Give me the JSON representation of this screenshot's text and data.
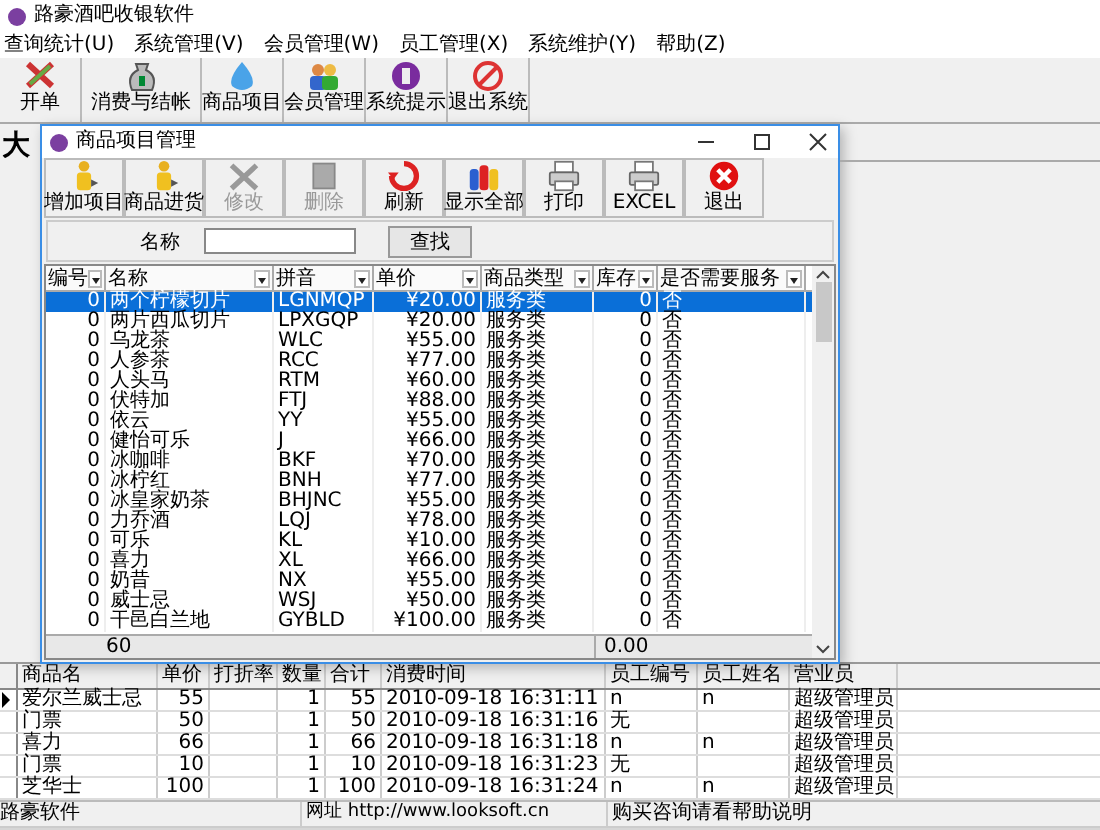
{
  "app": {
    "title": "路豪酒吧收银软件"
  },
  "menu": [
    "查询统计(U)",
    "系统管理(V)",
    "会员管理(W)",
    "员工管理(X)",
    "系统维护(Y)",
    "帮助(Z)"
  ],
  "main_toolbar": [
    "开单",
    "消费与结帐",
    "商品项目",
    "会员管理",
    "系统提示",
    "退出系统"
  ],
  "hall_label": "大",
  "dialog": {
    "title": "商品项目管理",
    "toolbar": [
      {
        "label": "增加项目",
        "disabled": false
      },
      {
        "label": "商品进货",
        "disabled": false
      },
      {
        "label": "修改",
        "disabled": true
      },
      {
        "label": "删除",
        "disabled": true
      },
      {
        "label": "刷新",
        "disabled": false
      },
      {
        "label": "显示全部",
        "disabled": false
      },
      {
        "label": "打印",
        "disabled": false
      },
      {
        "label": "EXCEL",
        "disabled": false
      },
      {
        "label": "退出",
        "disabled": false
      }
    ],
    "search": {
      "label": "名称",
      "button": "查找"
    },
    "columns": [
      "编号",
      "名称",
      "拼音",
      "单价",
      "商品类型",
      "库存",
      "是否需要服务"
    ],
    "rows": [
      {
        "cells": [
          "0",
          "两个柠檬切片",
          "LGNMQP",
          "¥20.00",
          "服务类",
          "0",
          "否"
        ],
        "selected": true
      },
      {
        "cells": [
          "0",
          "两片西瓜切片",
          "LPXGQP",
          "¥20.00",
          "服务类",
          "0",
          "否"
        ],
        "selected": false
      },
      {
        "cells": [
          "0",
          "乌龙茶",
          "WLC",
          "¥55.00",
          "服务类",
          "0",
          "否"
        ],
        "selected": false
      },
      {
        "cells": [
          "0",
          "人参茶",
          "RCC",
          "¥77.00",
          "服务类",
          "0",
          "否"
        ],
        "selected": false
      },
      {
        "cells": [
          "0",
          "人头马",
          "RTM",
          "¥60.00",
          "服务类",
          "0",
          "否"
        ],
        "selected": false
      },
      {
        "cells": [
          "0",
          "伏特加",
          "FTJ",
          "¥88.00",
          "服务类",
          "0",
          "否"
        ],
        "selected": false
      },
      {
        "cells": [
          "0",
          "依云",
          "YY",
          "¥55.00",
          "服务类",
          "0",
          "否"
        ],
        "selected": false
      },
      {
        "cells": [
          "0",
          "健怡可乐",
          "J",
          "¥66.00",
          "服务类",
          "0",
          "否"
        ],
        "selected": false
      },
      {
        "cells": [
          "0",
          "冰咖啡",
          "BKF",
          "¥70.00",
          "服务类",
          "0",
          "否"
        ],
        "selected": false
      },
      {
        "cells": [
          "0",
          "冰柠红",
          "BNH",
          "¥77.00",
          "服务类",
          "0",
          "否"
        ],
        "selected": false
      },
      {
        "cells": [
          "0",
          "冰皇家奶茶",
          "BHJNC",
          "¥55.00",
          "服务类",
          "0",
          "否"
        ],
        "selected": false
      },
      {
        "cells": [
          "0",
          "力乔酒",
          "LQJ",
          "¥78.00",
          "服务类",
          "0",
          "否"
        ],
        "selected": false
      },
      {
        "cells": [
          "0",
          "可乐",
          "KL",
          "¥10.00",
          "服务类",
          "0",
          "否"
        ],
        "selected": false
      },
      {
        "cells": [
          "0",
          "喜力",
          "XL",
          "¥66.00",
          "服务类",
          "0",
          "否"
        ],
        "selected": false
      },
      {
        "cells": [
          "0",
          "奶昔",
          "NX",
          "¥55.00",
          "服务类",
          "0",
          "否"
        ],
        "selected": false
      },
      {
        "cells": [
          "0",
          "威士忌",
          "WSJ",
          "¥50.00",
          "服务类",
          "0",
          "否"
        ],
        "selected": false
      },
      {
        "cells": [
          "0",
          "干邑白兰地",
          "GYBLD",
          "¥100.00",
          "服务类",
          "0",
          "否"
        ],
        "selected": false
      }
    ],
    "footer": [
      "60",
      "0.00"
    ]
  },
  "sales_grid": {
    "columns": [
      "商品名",
      "单价",
      "打折率",
      "数量",
      "合计",
      "消费时间",
      "员工编号",
      "员工姓名",
      "营业员"
    ],
    "rows": [
      {
        "current": true,
        "name": "爱尔兰威士忌",
        "price": "55",
        "qty": "1",
        "total": "55",
        "time": "2010-09-18 16:31:11",
        "staff_no": "n",
        "staff_name": "n",
        "operator": "超级管理员"
      },
      {
        "current": false,
        "name": "门票",
        "price": "50",
        "qty": "1",
        "total": "50",
        "time": "2010-09-18 16:31:16",
        "staff_no": "无",
        "operator": "超级管理员"
      },
      {
        "current": false,
        "name": "喜力",
        "price": "66",
        "qty": "1",
        "total": "66",
        "time": "2010-09-18 16:31:18",
        "staff_no": "n",
        "staff_name": "n",
        "operator": "超级管理员"
      },
      {
        "current": false,
        "name": "门票",
        "price": "10",
        "qty": "1",
        "total": "10",
        "time": "2010-09-18 16:31:23",
        "staff_no": "无",
        "operator": "超级管理员"
      },
      {
        "current": false,
        "name": "芝华士",
        "price": "100",
        "qty": "1",
        "total": "100",
        "time": "2010-09-18 16:31:24",
        "staff_no": "n",
        "staff_name": "n",
        "operator": "超级管理员"
      }
    ]
  },
  "status_bar": [
    "路豪软件",
    "网址 http://www.looksoft.cn",
    "购买咨询请看帮助说明"
  ]
}
